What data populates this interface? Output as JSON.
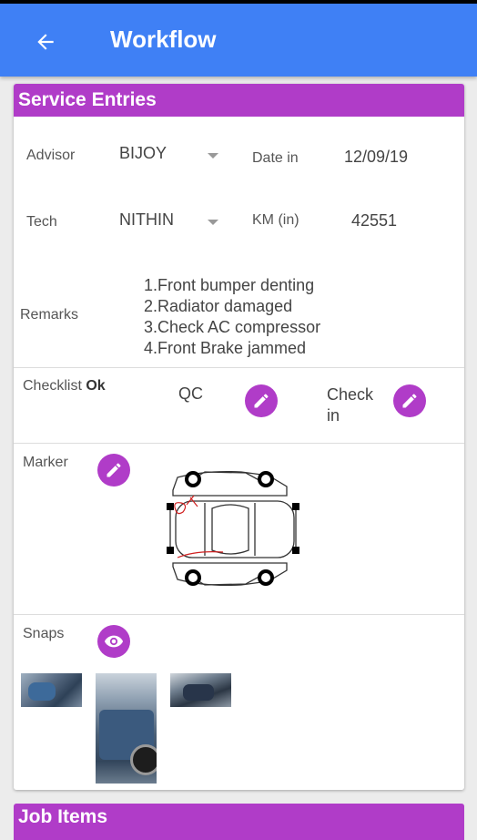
{
  "appbar": {
    "title": "Workflow",
    "back_icon": "arrow-left-icon"
  },
  "service": {
    "header": "Service Entries",
    "advisor_label": "Advisor",
    "advisor_value": "BIJOY",
    "date_label": "Date in",
    "date_value": "12/09/19",
    "tech_label": "Tech",
    "tech_value": "NITHIN",
    "km_label": "KM (in)",
    "km_value": "42551",
    "remarks_label": "Remarks",
    "remarks": [
      "1.Front bumper denting",
      "2.Radiator damaged",
      "3.Check AC compressor",
      "4.Front Brake jammed"
    ],
    "checklist_label": "Checklist",
    "checklist_status": "Ok",
    "qc_label": "QC",
    "checkin_label_1": "Check",
    "checkin_label_2": "in",
    "marker_label": "Marker",
    "snaps_label": "Snaps"
  },
  "job_items": {
    "header": "Job Items"
  },
  "colors": {
    "appbar": "#3f80f5",
    "accent": "#b03cc8",
    "marker_ink": "#d02020"
  },
  "icons": {
    "edit": "pencil-icon",
    "view": "eye-icon",
    "dropdown": "caret-down-icon"
  }
}
